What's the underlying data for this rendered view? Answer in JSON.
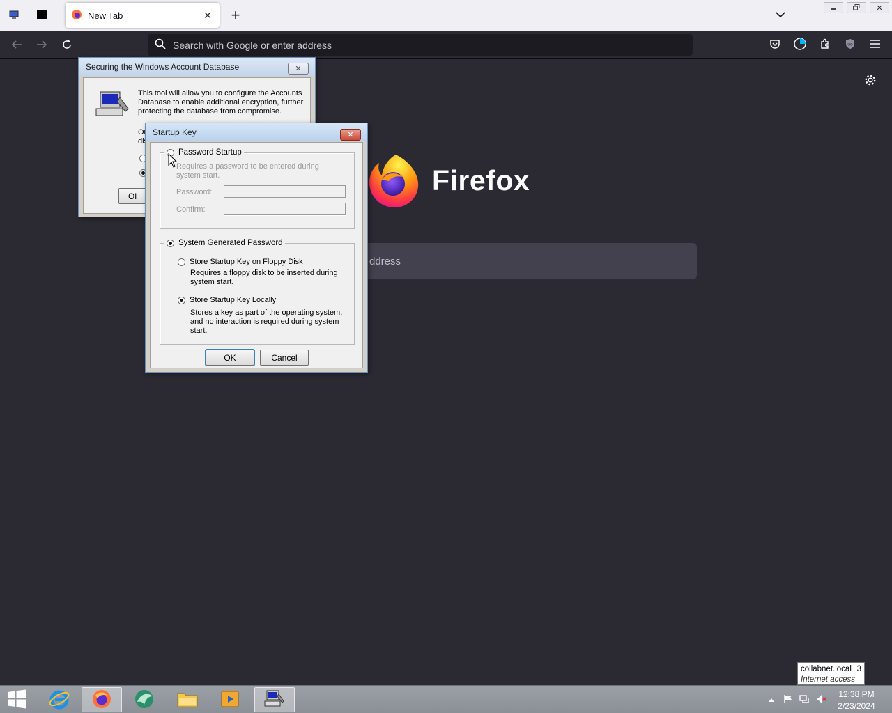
{
  "browser": {
    "tab": {
      "title": "New Tab"
    },
    "urlbar": {
      "placeholder": "Search with Google or enter address"
    }
  },
  "newtab": {
    "wordmark": "Firefox",
    "search_visible_text": "ddress"
  },
  "dialog_syskey": {
    "title": "Securing the Windows Account Database",
    "description": "This tool will allow you to configure the Accounts Database to enable additional encryption, further protecting the database from compromise.",
    "partial_text_1": "Or",
    "partial_text_2": "dis",
    "partial_ok": "Ol"
  },
  "dialog_startup": {
    "title": "Startup Key",
    "password_startup": {
      "label": "Password Startup",
      "selected": false,
      "description": "Requires a password to be entered during system start.",
      "password_label": "Password:",
      "confirm_label": "Confirm:"
    },
    "system_generated": {
      "label": "System Generated Password",
      "selected": true,
      "floppy": {
        "label": "Store Startup Key on Floppy Disk",
        "selected": false,
        "description": "Requires a floppy disk to be inserted during system start."
      },
      "local": {
        "label": "Store Startup Key Locally",
        "selected": true,
        "description": "Stores a key as part of the operating system, and no interaction is required during system start."
      }
    },
    "ok_label": "OK",
    "cancel_label": "Cancel"
  },
  "taskbar": {
    "clock_time": "12:38 PM",
    "clock_date": "2/23/2024",
    "tooltip_line1": "collabnet.local",
    "tooltip_badge": "3",
    "tooltip_line2": "Internet access"
  },
  "colors": {
    "browser_bg": "#2b2a33",
    "urlbar_bg": "#1c1b22",
    "dialog_bg": "#f0f0f0",
    "close_red": "#c94a3a"
  }
}
